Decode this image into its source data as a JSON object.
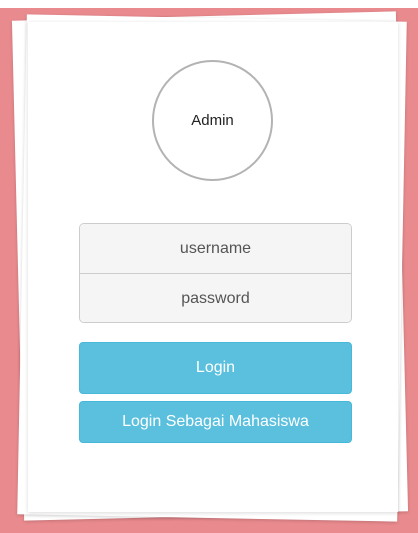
{
  "avatar": {
    "label": "Admin"
  },
  "form": {
    "username_placeholder": "username",
    "password_placeholder": "password",
    "username_value": "",
    "password_value": ""
  },
  "buttons": {
    "login_label": "Login",
    "mahasiswa_label": "Login Sebagai Mahasiswa"
  },
  "colors": {
    "background_accent": "#e98a8e",
    "button_primary": "#5bc0de",
    "button_border": "#46b8da"
  }
}
